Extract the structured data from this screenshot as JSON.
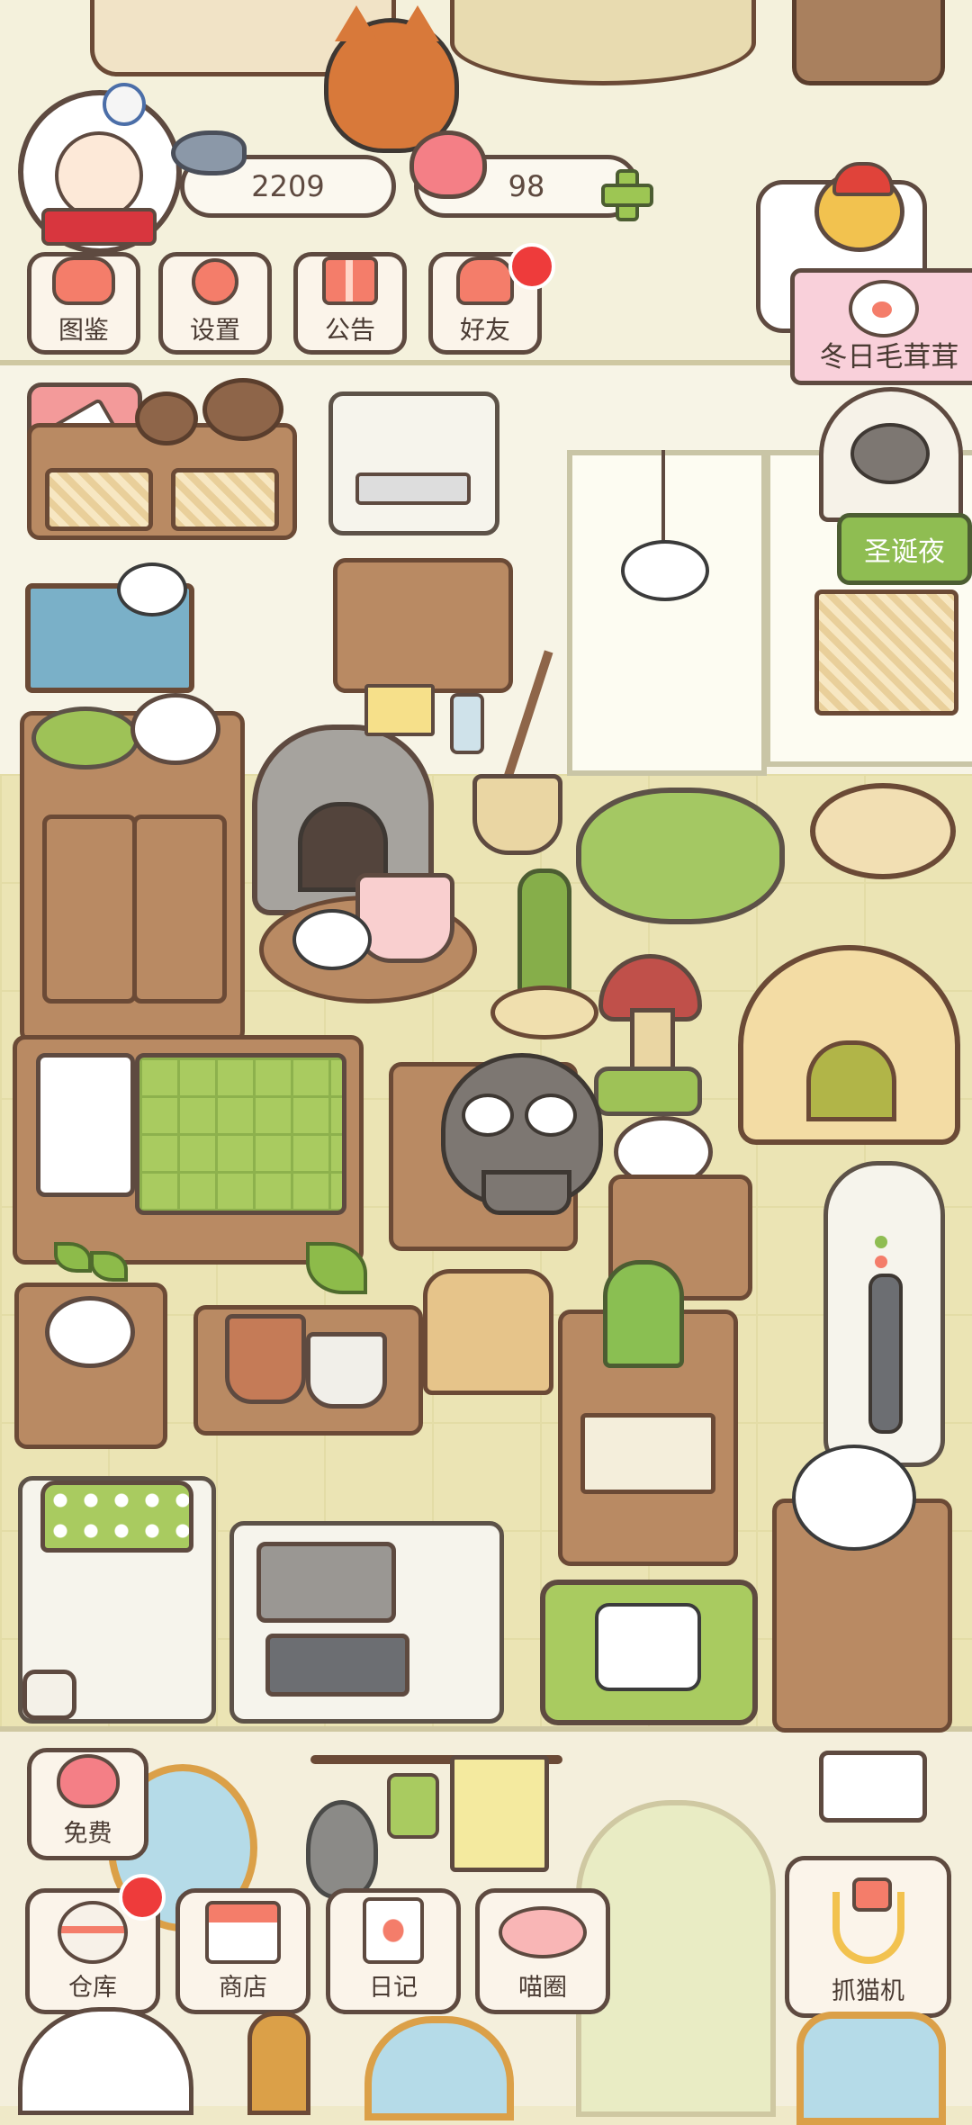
{
  "hud": {
    "coins": "2209",
    "hearts": "98"
  },
  "menu": [
    {
      "label": "图鉴",
      "icon": "cat-head-icon"
    },
    {
      "label": "设置",
      "icon": "gear-icon"
    },
    {
      "label": "公告",
      "icon": "gift-icon"
    },
    {
      "label": "好友",
      "icon": "friends-icon"
    }
  ],
  "event_banner": "冬日毛茸茸",
  "christmas_tag": "圣诞夜",
  "bottom": {
    "free_label": "免费",
    "warehouse_label": "仓库",
    "shop_label": "商店",
    "diary_label": "日记",
    "circle_label": "喵圈",
    "claw_label": "抓猫机"
  },
  "colors": {
    "accent_green": "#8fbd52",
    "badge_red": "#ee3b3b",
    "outline_brown": "#5e4a40",
    "floor": "#ebe4b4"
  }
}
